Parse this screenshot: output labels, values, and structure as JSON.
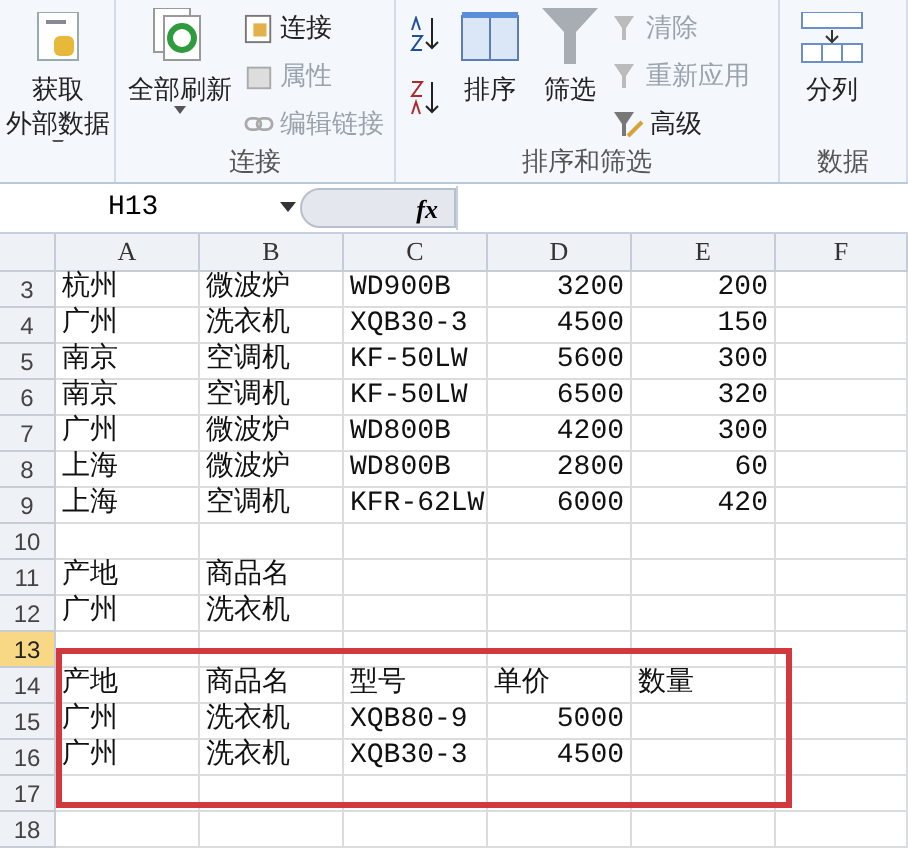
{
  "ribbon": {
    "groups": [
      {
        "buttons": [
          {
            "label_lines": [
              "获取",
              "外部数据"
            ],
            "kind": "get-data",
            "disabled": false,
            "dropdown": true
          }
        ]
      },
      {
        "label": "连接",
        "buttons": [
          {
            "label_lines": [
              "全部刷新"
            ],
            "kind": "refresh",
            "disabled": false,
            "dropdown": true
          },
          {
            "label": "连接",
            "kind": "connections",
            "disabled": false
          },
          {
            "label": "属性",
            "kind": "properties",
            "disabled": true
          },
          {
            "label": "编辑链接",
            "kind": "edit-links",
            "disabled": true
          }
        ]
      },
      {
        "label": "排序和筛选",
        "buttons": [
          {
            "kind": "sort-asc",
            "disabled": false
          },
          {
            "kind": "sort-desc",
            "disabled": false
          },
          {
            "label_lines": [
              "排序"
            ],
            "kind": "sort",
            "disabled": false
          },
          {
            "label_lines": [
              "筛选"
            ],
            "kind": "filter",
            "disabled": false
          },
          {
            "label": "清除",
            "kind": "clear",
            "disabled": true
          },
          {
            "label": "重新应用",
            "kind": "reapply",
            "disabled": true
          },
          {
            "label": "高级",
            "kind": "advanced",
            "disabled": false
          }
        ]
      },
      {
        "label": "数据",
        "buttons": [
          {
            "label_lines": [
              "分列"
            ],
            "kind": "text-to-columns",
            "disabled": false
          }
        ]
      }
    ]
  },
  "formula_bar": {
    "name_box": "H13",
    "function_button": "fx"
  },
  "columns": [
    {
      "label": "A",
      "kind": "text"
    },
    {
      "label": "B",
      "kind": "text"
    },
    {
      "label": "C",
      "kind": "text"
    },
    {
      "label": "D",
      "kind": "number"
    },
    {
      "label": "E",
      "kind": "number"
    },
    {
      "label": "F",
      "kind": "text"
    }
  ],
  "rows": [
    {
      "number": "3",
      "selected": false,
      "in_box": false,
      "kind": "record",
      "cells": [
        "杭州",
        "微波炉",
        "WD900B",
        "3200",
        "200"
      ]
    },
    {
      "number": "4",
      "selected": false,
      "in_box": false,
      "kind": "record",
      "cells": [
        "广州",
        "洗衣机",
        "XQB30-3",
        "4500",
        "150"
      ]
    },
    {
      "number": "5",
      "selected": false,
      "in_box": false,
      "kind": "record",
      "cells": [
        "南京",
        "空调机",
        "KF-50LW",
        "5600",
        "300"
      ]
    },
    {
      "number": "6",
      "selected": false,
      "in_box": false,
      "kind": "record",
      "cells": [
        "南京",
        "空调机",
        "KF-50LW",
        "6500",
        "320"
      ]
    },
    {
      "number": "7",
      "selected": false,
      "in_box": false,
      "kind": "record",
      "cells": [
        "广州",
        "微波炉",
        "WD800B",
        "4200",
        "300"
      ]
    },
    {
      "number": "8",
      "selected": false,
      "in_box": false,
      "kind": "record",
      "cells": [
        "上海",
        "微波炉",
        "WD800B",
        "2800",
        "60"
      ]
    },
    {
      "number": "9",
      "selected": false,
      "in_box": false,
      "kind": "record",
      "cells": [
        "上海",
        "空调机",
        "KFR-62LW",
        "6000",
        "420"
      ]
    },
    {
      "number": "10",
      "selected": false,
      "in_box": false,
      "kind": "record"
    },
    {
      "number": "11",
      "selected": false,
      "in_box": false,
      "kind": "label",
      "cells": [
        "产地",
        "商品名"
      ]
    },
    {
      "number": "12",
      "selected": false,
      "in_box": false,
      "kind": "label",
      "cells": [
        "广州",
        "洗衣机"
      ]
    },
    {
      "number": "13",
      "selected": true,
      "in_box": true,
      "kind": "record"
    },
    {
      "number": "14",
      "selected": false,
      "in_box": true,
      "kind": "label",
      "cells": [
        "产地",
        "商品名",
        "型号",
        "单价",
        "数量"
      ]
    },
    {
      "number": "15",
      "selected": false,
      "in_box": true,
      "kind": "record",
      "cells": [
        "广州",
        "洗衣机",
        "XQB80-9",
        "5000"
      ]
    },
    {
      "number": "16",
      "selected": false,
      "in_box": true,
      "kind": "record",
      "cells": [
        "广州",
        "洗衣机",
        "XQB30-3",
        "4500"
      ]
    },
    {
      "number": "17",
      "selected": false,
      "in_box": true,
      "kind": "record"
    },
    {
      "number": "18",
      "selected": false,
      "in_box": false,
      "kind": "record"
    }
  ]
}
